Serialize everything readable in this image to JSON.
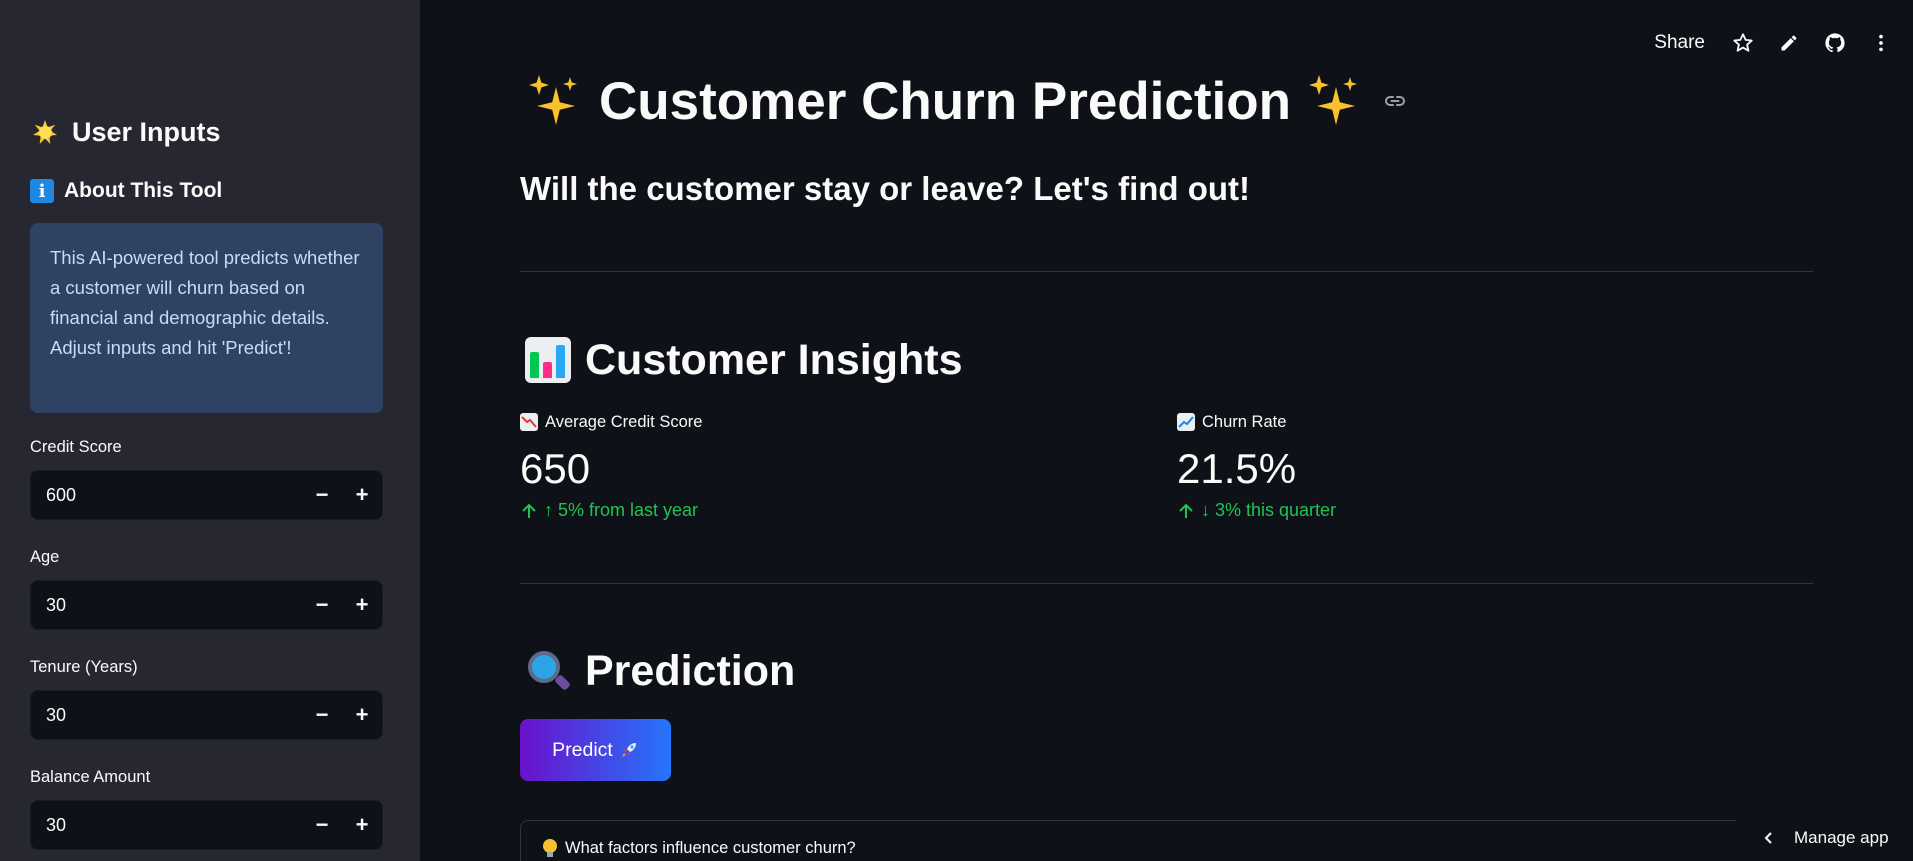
{
  "sidebar": {
    "title": "User Inputs",
    "about_title": "About This Tool",
    "about_text": "This AI-powered tool predicts whether a customer will churn based on financial and demographic details. Adjust inputs and hit 'Predict'!",
    "fields": [
      {
        "label": "Credit Score",
        "value": "600"
      },
      {
        "label": "Age",
        "value": "30"
      },
      {
        "label": "Tenure (Years)",
        "value": "30"
      },
      {
        "label": "Balance Amount",
        "value": "30"
      }
    ],
    "minus": "−",
    "plus": "+"
  },
  "toolbar": {
    "share_label": "Share",
    "icons": [
      "star-icon",
      "pencil-icon",
      "github-icon",
      "more-vertical-icon"
    ]
  },
  "main": {
    "title": "Customer Churn Prediction",
    "subtitle": "Will the customer stay or leave? Let's find out!",
    "insights_heading": "Customer Insights",
    "metrics": [
      {
        "label": "Average Credit Score",
        "value": "650",
        "delta": "↑ 5% from last year",
        "delta_color": "#21c354"
      },
      {
        "label": "Churn Rate",
        "value": "21.5%",
        "delta": "↓ 3% this quarter",
        "delta_color": "#21c354"
      }
    ],
    "prediction_heading": "Prediction",
    "predict_button": "Predict",
    "expander_label": "What factors influence customer churn?"
  },
  "footer": {
    "manage_app": "Manage app"
  },
  "colors": {
    "background": "#0e1117",
    "sidebar": "#262730",
    "info_box": "#2f4263",
    "accent_gradient_start": "#6a11cb",
    "accent_gradient_end": "#2575fc",
    "delta_green": "#21c354"
  }
}
